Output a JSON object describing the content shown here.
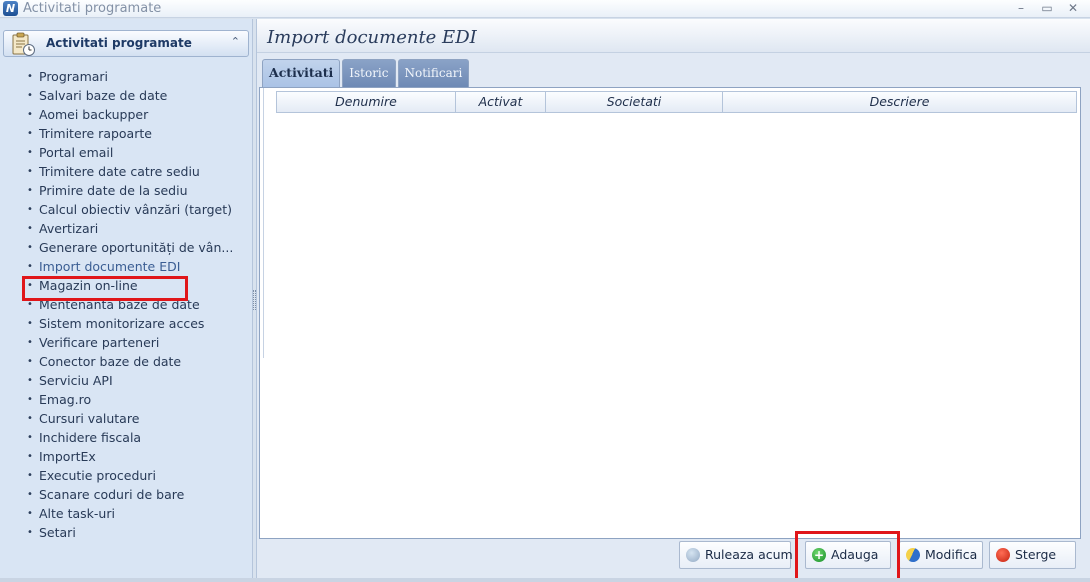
{
  "window": {
    "app_icon_letter": "N",
    "title": "Activitati programate",
    "minimize": "–",
    "maximize": "▭",
    "close": "✕"
  },
  "sidebar": {
    "header": "Activitati programate",
    "collapse_glyph": "⌃",
    "items": [
      {
        "label": "Programari"
      },
      {
        "label": "Salvari baze de date"
      },
      {
        "label": "Aomei backupper"
      },
      {
        "label": "Trimitere rapoarte"
      },
      {
        "label": "Portal email"
      },
      {
        "label": "Trimitere date catre sediu"
      },
      {
        "label": "Primire date de la sediu"
      },
      {
        "label": "Calcul obiectiv vânzări (target)"
      },
      {
        "label": "Avertizari"
      },
      {
        "label": "Generare oportunități de vân..."
      },
      {
        "label": "Import documente EDI",
        "selected": true
      },
      {
        "label": "Magazin on-line"
      },
      {
        "label": "Mentenanta baze de date"
      },
      {
        "label": "Sistem monitorizare acces"
      },
      {
        "label": "Verificare parteneri"
      },
      {
        "label": "Conector baze de date"
      },
      {
        "label": "Serviciu API"
      },
      {
        "label": "Emag.ro"
      },
      {
        "label": "Cursuri valutare"
      },
      {
        "label": "Inchidere fiscala"
      },
      {
        "label": "ImportEx"
      },
      {
        "label": "Executie proceduri"
      },
      {
        "label": "Scanare coduri de bare"
      },
      {
        "label": "Alte task-uri"
      },
      {
        "label": "Setari"
      }
    ]
  },
  "main": {
    "title": "Import documente EDI",
    "tabs": [
      {
        "label": "Activitati",
        "active": true
      },
      {
        "label": "Istoric",
        "active": false
      },
      {
        "label": "Notificari",
        "active": false
      }
    ],
    "grid": {
      "columns": [
        "Denumire",
        "Activat",
        "Societati",
        "Descriere"
      ],
      "rows": []
    },
    "buttons": {
      "run": "Ruleaza acum",
      "add": "Adauga",
      "modify": "Modifica",
      "delete": "Sterge"
    }
  },
  "colors": {
    "highlight": "#e0161a",
    "tab_active": "#a9c2e5",
    "tab_inactive": "#7b95bd",
    "panel_bg": "#d9e5f4"
  }
}
